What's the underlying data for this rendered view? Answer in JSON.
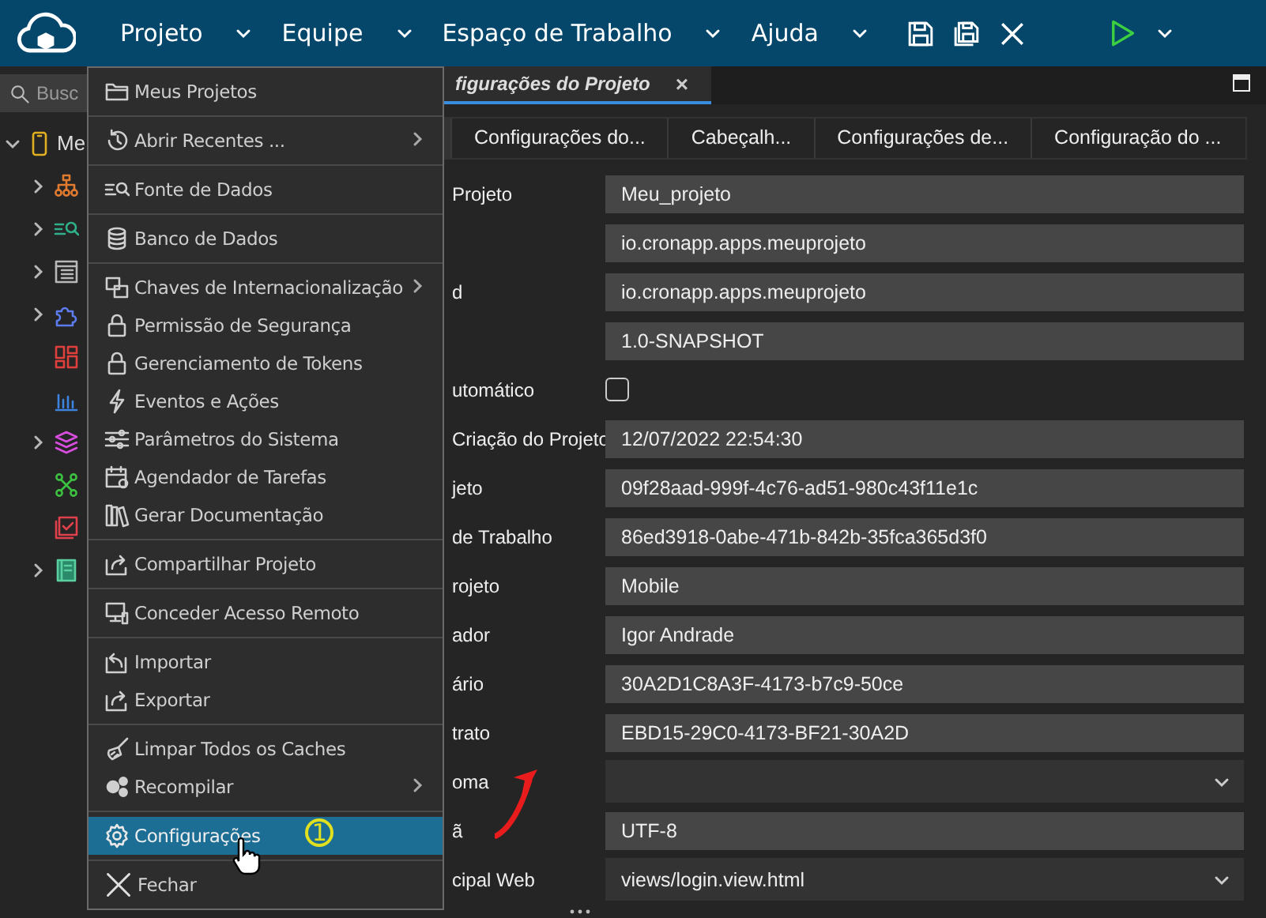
{
  "top_bar": {
    "menus": [
      {
        "label": "Projeto"
      },
      {
        "label": "Equipe"
      },
      {
        "label": "Espaço de Trabalho"
      },
      {
        "label": "Ajuda"
      }
    ]
  },
  "sidebar": {
    "search": {
      "placeholder": "Busc"
    },
    "tree": [
      {
        "label": "Me",
        "expanded": true,
        "children": [
          {
            "has_children": true
          },
          {
            "has_children": true
          },
          {
            "has_children": true
          },
          {
            "has_children": true
          },
          {
            "has_children": false
          },
          {
            "has_children": false
          },
          {
            "has_children": true
          },
          {
            "has_children": false
          },
          {
            "has_children": false
          },
          {
            "has_children": true
          }
        ]
      }
    ]
  },
  "editor": {
    "tabs": [
      {
        "label": "figurações do Projeto",
        "close_glyph": "×",
        "selected": true
      }
    ],
    "subtabs": [
      {
        "label": "Configurações do..."
      },
      {
        "label": "Cabeçalh..."
      },
      {
        "label": "Configurações de..."
      },
      {
        "label": "Configuração do ..."
      }
    ],
    "fields": [
      {
        "kind": "text",
        "label": "Projeto",
        "value": "Meu_projeto"
      },
      {
        "kind": "text",
        "value": "io.cronapp.apps.meuprojeto"
      },
      {
        "kind": "text",
        "label": "d",
        "value": "io.cronapp.apps.meuprojeto"
      },
      {
        "kind": "text",
        "value": "1.0-SNAPSHOT"
      },
      {
        "kind": "checkbox",
        "label": "utomático",
        "checked": false
      },
      {
        "kind": "text",
        "label": "Criação do Projeto",
        "value": "12/07/2022 22:54:30"
      },
      {
        "kind": "text",
        "label": "jeto",
        "value": "09f28aad-999f-4c76-ad51-980c43f11e1c"
      },
      {
        "kind": "text",
        "label": "de Trabalho",
        "value": "86ed3918-0abe-471b-842b-35fca365d3f0"
      },
      {
        "kind": "text",
        "label": "rojeto",
        "value": "Mobile"
      },
      {
        "kind": "text",
        "label": "ador",
        "value": "Igor Andrade"
      },
      {
        "kind": "text",
        "label": "ário",
        "value": "30A2D1C8A3F-4173-b7c9-50ce"
      },
      {
        "kind": "text",
        "label": "trato",
        "value": "EBD15-29C0-4173-BF21-30A2D"
      },
      {
        "kind": "select",
        "label": "oma"
      },
      {
        "kind": "text",
        "label": "ã",
        "value": "UTF-8"
      },
      {
        "kind": "select",
        "label": "cipal Web",
        "value": "views/login.view.html"
      }
    ]
  },
  "menu": {
    "groups": [
      [
        {
          "label": "Meus Projetos",
          "has_submenu": false,
          "selected": false
        }
      ],
      [
        {
          "label": "Abrir Recentes ...",
          "has_submenu": true,
          "selected": false
        }
      ],
      [
        {
          "label": "Fonte de Dados",
          "has_submenu": false,
          "selected": false
        }
      ],
      [
        {
          "label": "Banco de Dados",
          "has_submenu": false,
          "selected": false
        }
      ],
      [
        {
          "label": "Chaves de Internacionalização",
          "has_submenu": true,
          "selected": false
        },
        {
          "label": "Permissão de Segurança",
          "has_submenu": false,
          "selected": false
        },
        {
          "label": "Gerenciamento de Tokens",
          "has_submenu": false,
          "selected": false
        },
        {
          "label": "Eventos e Ações",
          "has_submenu": false,
          "selected": false
        },
        {
          "label": "Parâmetros do Sistema",
          "has_submenu": false,
          "selected": false
        },
        {
          "label": "Agendador de Tarefas",
          "has_submenu": false,
          "selected": false
        },
        {
          "label": "Gerar Documentação",
          "has_submenu": false,
          "selected": false
        }
      ],
      [
        {
          "label": "Compartilhar Projeto",
          "has_submenu": false,
          "selected": false
        }
      ],
      [
        {
          "label": "Conceder Acesso Remoto",
          "has_submenu": false,
          "selected": false
        }
      ],
      [
        {
          "label": "Importar",
          "has_submenu": false,
          "selected": false
        },
        {
          "label": "Exportar",
          "has_submenu": false,
          "selected": false
        }
      ],
      [
        {
          "label": "Limpar Todos os Caches",
          "has_submenu": false,
          "selected": false
        },
        {
          "label": "Recompilar",
          "has_submenu": true,
          "selected": false
        }
      ],
      [
        {
          "label": "Configurações",
          "has_submenu": false,
          "selected": true,
          "badge": "1"
        }
      ],
      [
        {
          "label": "Fechar",
          "has_submenu": false,
          "selected": false
        }
      ]
    ]
  }
}
